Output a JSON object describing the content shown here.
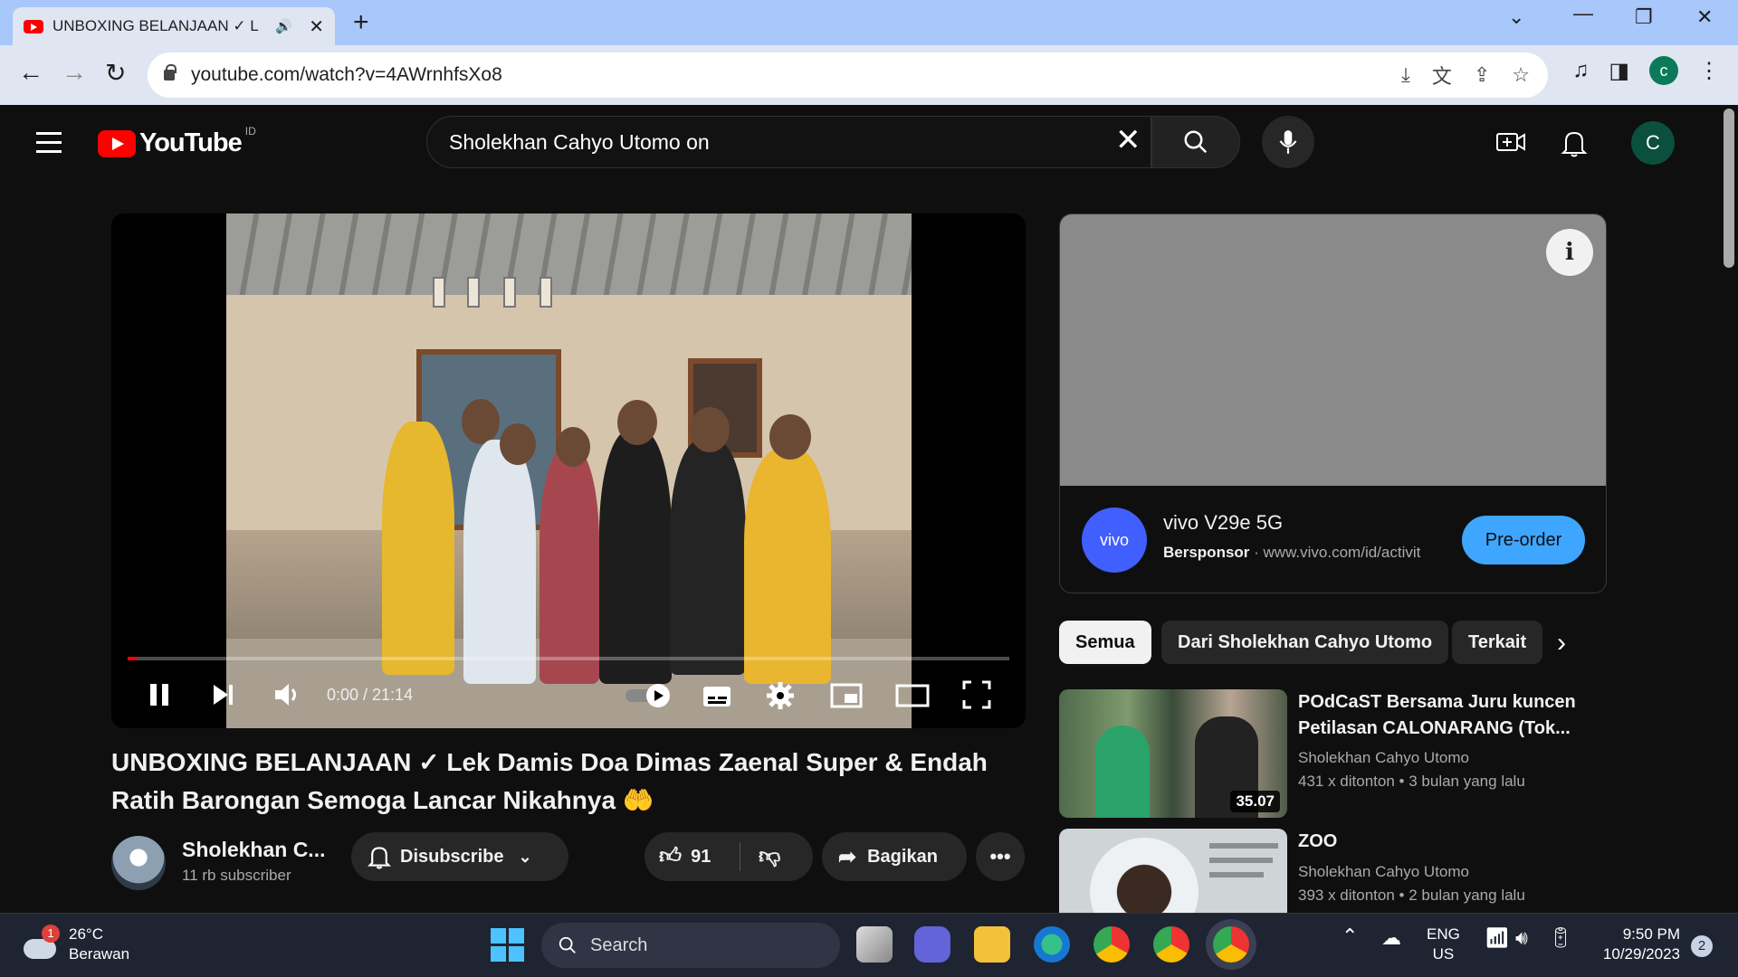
{
  "browser": {
    "tab_title": "UNBOXING BELANJAAN ✓ L",
    "new_tab": "+",
    "url": "youtube.com/watch?v=4AWrnhfsXo8",
    "profile_initial": "c"
  },
  "youtube": {
    "logo_text": "YouTube",
    "country_code": "ID",
    "search_query": "Sholekhan Cahyo Utomo on",
    "avatar_initial": "C"
  },
  "player": {
    "time": "0:00 / 21:14",
    "progress_fraction": 0.01
  },
  "video": {
    "title": "UNBOXING BELANJAAN ✓ Lek Damis Doa Dimas Zaenal Super & Endah Ratih Barongan Semoga Lancar Nikahnya",
    "title_emoji": "🤲",
    "channel_name": "Sholekhan C...",
    "subscribers": "11 rb subscriber",
    "subscribe_label": "Disubscribe",
    "likes": "91",
    "share_label": "Bagikan"
  },
  "ad": {
    "logo_text": "vivo",
    "title": "vivo V29e 5G",
    "sponsored": "Bersponsor",
    "domain": "www.vivo.com/id/activit",
    "cta": "Pre-order",
    "info_glyph": "i"
  },
  "chips": [
    "Semua",
    "Dari Sholekhan Cahyo Utomo",
    "Terkait"
  ],
  "recommendations": [
    {
      "title": "POdCaST Bersama Juru kuncen Petilasan CALONARANG (Tok...",
      "channel": "Sholekhan Cahyo Utomo",
      "views": "431 x ditonton",
      "age": "3 bulan yang lalu",
      "duration": "35.07"
    },
    {
      "title": "ZOO",
      "channel": "Sholekhan Cahyo Utomo",
      "views": "393 x ditonton",
      "age": "2 bulan yang lalu"
    }
  ],
  "taskbar": {
    "weather_temp": "26°C",
    "weather_desc": "Berawan",
    "weather_badge": "1",
    "search_label": "Search",
    "lang_line1": "ENG",
    "lang_line2": "US",
    "time": "9:50 PM",
    "date": "10/29/2023",
    "notification_count": "2"
  }
}
